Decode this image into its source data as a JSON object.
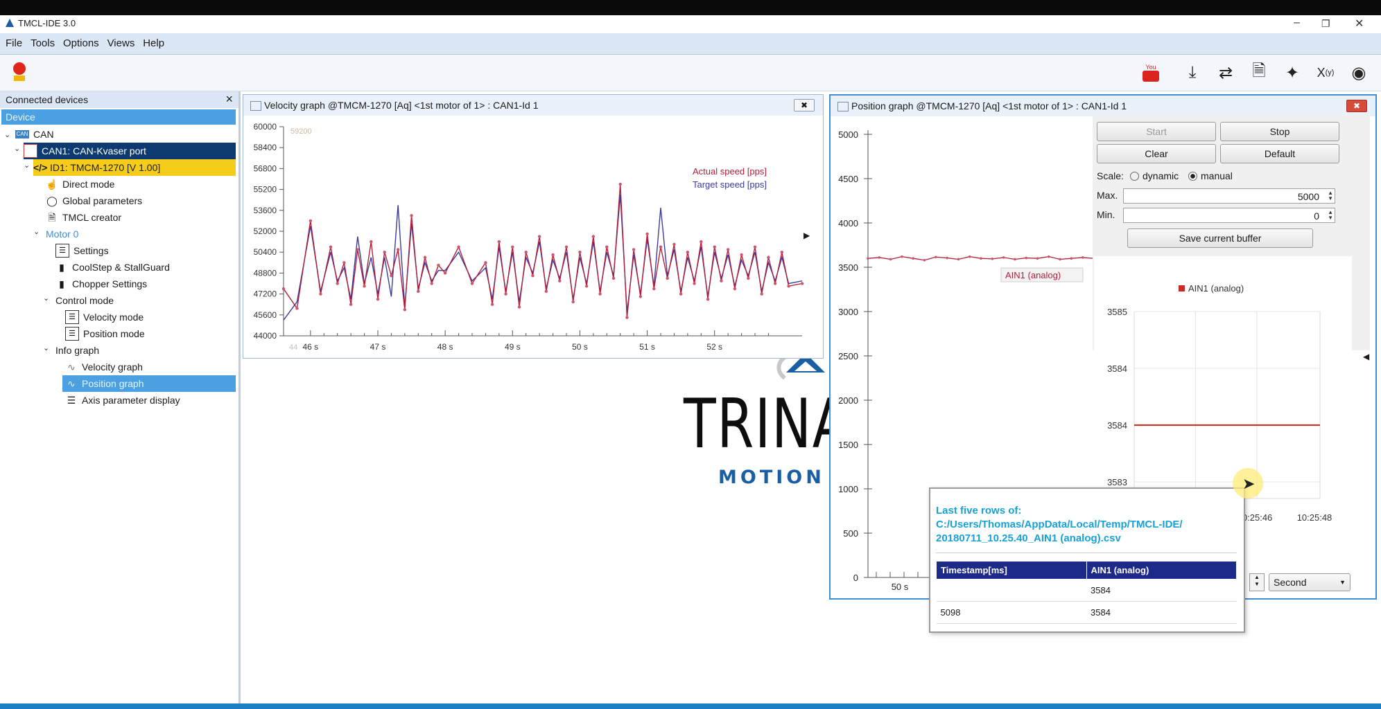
{
  "app": {
    "title": "TMCL-IDE 3.0"
  },
  "menu": [
    "File",
    "Tools",
    "Options",
    "Views",
    "Help"
  ],
  "toolbar_icons": [
    "youtube-icon",
    "download-icon",
    "transfer-icon",
    "document-icon",
    "wand-icon",
    "variable-icon",
    "eye-icon"
  ],
  "left_panel": {
    "title": "Connected devices",
    "device_header": "Device",
    "tree": {
      "can": "CAN",
      "can_port": "CAN1: CAN-Kvaser port",
      "device": "ID1: TMCM-1270 [V 1.00]",
      "direct_mode": "Direct mode",
      "global_parameters": "Global parameters",
      "tmcl_creator": "TMCL creator",
      "motor0": "Motor 0",
      "settings": "Settings",
      "coolstep": "CoolStep & StallGuard",
      "chopper": "Chopper Settings",
      "control_mode": "Control mode",
      "velocity_mode": "Velocity mode",
      "position_mode": "Position mode",
      "info_graph": "Info graph",
      "velocity_graph": "Velocity graph",
      "position_graph": "Position graph",
      "axis_param": "Axis parameter display"
    }
  },
  "velocity_window": {
    "title": "Velocity graph @TMCM-1270 [Aq] <1st motor of 1> : CAN1-Id 1",
    "y_ticks": [
      "60000",
      "58400",
      "56800",
      "55200",
      "53600",
      "52000",
      "50400",
      "48800",
      "47200",
      "45600",
      "44000"
    ],
    "x_ticks": [
      "46 s",
      "47 s",
      "48 s",
      "49 s",
      "50 s",
      "51 s",
      "52 s"
    ],
    "top_value": "59200",
    "bottom_value": "44",
    "legend_actual": "Actual speed [pps]",
    "legend_target": "Target speed [pps]",
    "colors": {
      "actual": "#b01f3a",
      "target": "#3a3aa0"
    }
  },
  "position_window": {
    "title": "Position graph @TMCM-1270 [Aq] <1st motor of 1> : CAN1-Id 1",
    "y_ticks": [
      "5000",
      "4500",
      "4000",
      "3500",
      "3000",
      "2500",
      "2000",
      "1500",
      "1000",
      "500",
      "0"
    ],
    "x_tick": "50 s",
    "trace_label": "AIN1 (analog)",
    "buttons": {
      "start": "Start",
      "stop": "Stop",
      "clear": "Clear",
      "default": "Default",
      "save": "Save current buffer"
    },
    "scale_label": "Scale:",
    "scale_options": [
      "dynamic",
      "manual"
    ],
    "scale_selected": "manual",
    "max_label": "Max.",
    "max_value": "5000",
    "min_label": "Min.",
    "min_value": "0",
    "time_unit": "Second",
    "mini_chart": {
      "legend": "AIN1 (analog)",
      "y_labels": [
        "3585",
        "3584",
        "3584",
        "3583"
      ],
      "x_labels": [
        "10:25:46",
        "10:25:48"
      ]
    }
  },
  "popup": {
    "title_line1": "Last five rows of:",
    "title_line2": "C:/Users/Thomas/AppData/Local/Temp/TMCL-IDE/",
    "title_line3": "20180711_10.25.40_AIN1 (analog).csv",
    "columns": [
      "Timestamp[ms]",
      "AIN1 (analog)"
    ],
    "rows": [
      [
        "",
        "3584"
      ],
      [
        "5098",
        "3584"
      ]
    ]
  },
  "logo": {
    "brand": "TRINA",
    "tagline": "MOTION CO"
  },
  "chart_data": [
    {
      "type": "line",
      "title": "Velocity graph @TMCM-1270 [Aq] <1st motor of 1> : CAN1-Id 1",
      "xlabel": "",
      "ylabel": "",
      "ylim": [
        44000,
        60000
      ],
      "x_range_s": [
        45.6,
        53.3
      ],
      "series": [
        {
          "name": "Actual speed [pps]",
          "x": [
            45.6,
            45.8,
            46.0,
            46.15,
            46.3,
            46.4,
            46.5,
            46.6,
            46.7,
            46.8,
            46.9,
            47.0,
            47.1,
            47.2,
            47.3,
            47.4,
            47.5,
            47.6,
            47.7,
            47.8,
            47.9,
            48.0,
            48.2,
            48.4,
            48.6,
            48.7,
            48.8,
            48.9,
            49.0,
            49.1,
            49.2,
            49.3,
            49.4,
            49.5,
            49.6,
            49.7,
            49.8,
            49.9,
            50.0,
            50.1,
            50.2,
            50.3,
            50.4,
            50.5,
            50.6,
            50.7,
            50.8,
            50.9,
            51.0,
            51.1,
            51.2,
            51.3,
            51.4,
            51.5,
            51.6,
            51.7,
            51.8,
            51.9,
            52.0,
            52.1,
            52.2,
            52.3,
            52.4,
            52.5,
            52.6,
            52.7,
            52.8,
            52.9,
            53.0,
            53.1,
            53.3
          ],
          "values": [
            47600,
            46100,
            52800,
            47200,
            50800,
            48000,
            49600,
            46400,
            50600,
            47800,
            51200,
            46800,
            50400,
            48600,
            50600,
            46000,
            53200,
            47400,
            50000,
            48000,
            49400,
            48800,
            50800,
            48000,
            49600,
            46400,
            51200,
            47200,
            50800,
            46200,
            50400,
            48600,
            51600,
            47400,
            50200,
            48200,
            50800,
            46600,
            50400,
            47800,
            51600,
            47200,
            50800,
            48400,
            55600,
            45400,
            50600,
            47000,
            51800,
            47600,
            50800,
            48400,
            51000,
            47200,
            50400,
            48000,
            51200,
            46800,
            50800,
            48200,
            50600,
            47600,
            50200,
            48400,
            50800,
            47200,
            50000,
            48000,
            50400,
            47800,
            48000
          ]
        },
        {
          "name": "Target speed [pps]",
          "x": [
            45.6,
            45.8,
            46.0,
            46.15,
            46.3,
            46.4,
            46.5,
            46.6,
            46.7,
            46.8,
            46.9,
            47.0,
            47.1,
            47.2,
            47.3,
            47.4,
            47.5,
            47.6,
            47.7,
            47.8,
            47.9,
            48.0,
            48.2,
            48.4,
            48.6,
            48.7,
            48.8,
            48.9,
            49.0,
            49.1,
            49.2,
            49.3,
            49.4,
            49.5,
            49.6,
            49.7,
            49.8,
            49.9,
            50.0,
            50.1,
            50.2,
            50.3,
            50.4,
            50.5,
            50.6,
            50.7,
            50.8,
            50.9,
            51.0,
            51.1,
            51.2,
            51.3,
            51.4,
            51.5,
            51.6,
            51.7,
            51.8,
            51.9,
            52.0,
            52.1,
            52.2,
            52.3,
            52.4,
            52.5,
            52.6,
            52.7,
            52.8,
            52.9,
            53.0,
            53.1,
            53.3
          ],
          "values": [
            45200,
            46600,
            52400,
            47400,
            50400,
            48200,
            49200,
            46800,
            51600,
            48000,
            50000,
            47200,
            50000,
            47000,
            54000,
            46200,
            52600,
            47600,
            49600,
            48200,
            49000,
            49000,
            50400,
            48200,
            49200,
            46800,
            50800,
            47400,
            50400,
            46600,
            50000,
            48800,
            51200,
            47600,
            49800,
            48400,
            50400,
            46800,
            50000,
            48000,
            51200,
            47400,
            50400,
            48600,
            54800,
            45800,
            50200,
            47200,
            51400,
            47800,
            53800,
            48600,
            50600,
            47400,
            50000,
            48200,
            50800,
            47000,
            50400,
            48400,
            50200,
            47800,
            49800,
            48600,
            50400,
            47400,
            49600,
            48200,
            50000,
            48000,
            48200
          ]
        }
      ]
    },
    {
      "type": "line",
      "title": "Position graph @TMCM-1270 [Aq] <1st motor of 1> : CAN1-Id 1",
      "ylim": [
        0,
        5000
      ],
      "series": [
        {
          "name": "AIN1 (analog)",
          "values": [
            3600,
            3610,
            3590,
            3620,
            3600,
            3580,
            3615,
            3605,
            3590,
            3620,
            3600,
            3595,
            3610,
            3590,
            3605,
            3600,
            3620,
            3590,
            3600,
            3610,
            3600
          ]
        }
      ]
    },
    {
      "type": "line",
      "title": "",
      "categories": [
        "10:25:46",
        "10:25:48"
      ],
      "series": [
        {
          "name": "AIN1 (analog)",
          "values": [
            3584,
            3584
          ]
        }
      ],
      "ylim": [
        3583,
        3585
      ]
    }
  ]
}
